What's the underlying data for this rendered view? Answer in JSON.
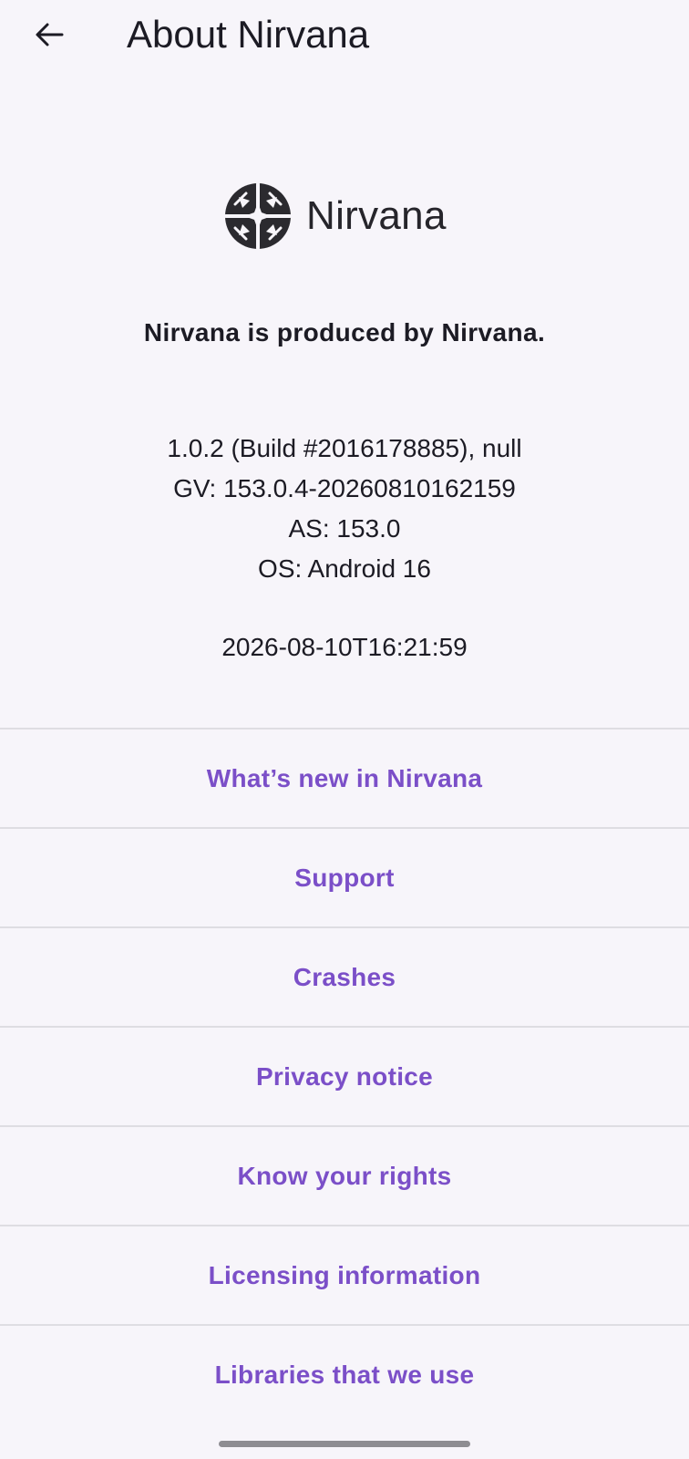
{
  "header": {
    "back_icon": "arrow-left-icon",
    "title": "About Nirvana"
  },
  "logo": {
    "icon": "nirvana-logo-icon",
    "wordmark": "Nirvana"
  },
  "producer_text": "Nirvana is produced by Nirvana.",
  "version_info": {
    "build": "1.0.2 (Build #2016178885), null",
    "gv": "GV: 153.0.4-20260810162159",
    "as": "AS: 153.0",
    "os": "OS: Android 16"
  },
  "build_date": "2026-08-10T16:21:59",
  "links": [
    {
      "label": "What’s new in Nirvana"
    },
    {
      "label": "Support"
    },
    {
      "label": "Crashes"
    },
    {
      "label": "Privacy notice"
    },
    {
      "label": "Know your rights"
    },
    {
      "label": "Licensing information"
    },
    {
      "label": "Libraries that we use"
    }
  ],
  "colors": {
    "background": "#f7f5fa",
    "link": "#7b4fc8",
    "text": "#1c1b24",
    "divider": "#dedde2"
  }
}
